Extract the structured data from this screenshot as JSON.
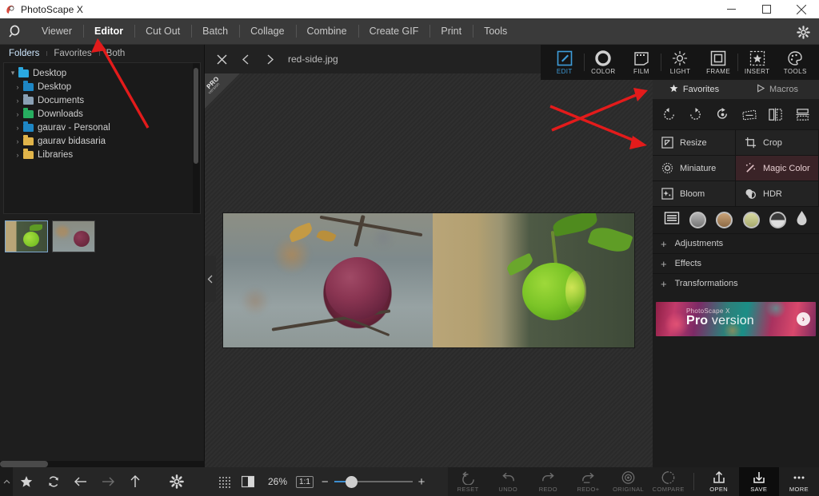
{
  "window": {
    "title": "PhotoScape X",
    "logo_icon": "photoscape-logo-icon",
    "minimize_icon": "minimize-icon",
    "maximize_icon": "maximize-icon",
    "close_icon": "close-icon"
  },
  "menubar": {
    "logo_icon": "magnifier-logo-icon",
    "gear_icon": "settings-gear-icon",
    "items": [
      {
        "label": "Viewer",
        "active": false
      },
      {
        "label": "Editor",
        "active": true
      },
      {
        "label": "Cut Out",
        "active": false
      },
      {
        "label": "Batch",
        "active": false
      },
      {
        "label": "Collage",
        "active": false
      },
      {
        "label": "Combine",
        "active": false
      },
      {
        "label": "Create GIF",
        "active": false
      },
      {
        "label": "Print",
        "active": false
      },
      {
        "label": "Tools",
        "active": false
      }
    ]
  },
  "left_panel": {
    "tabs": [
      {
        "label": "Folders",
        "active": true
      },
      {
        "label": "Favorites",
        "active": false
      },
      {
        "label": "Both",
        "active": false
      }
    ],
    "tree": [
      {
        "label": "Desktop",
        "indent": 0,
        "chevron": "▾",
        "color": "#2aa8e0"
      },
      {
        "label": "Desktop",
        "indent": 1,
        "chevron": "›",
        "color": "#1e86c4"
      },
      {
        "label": "Documents",
        "indent": 1,
        "chevron": "›",
        "color": "#8aa0b4"
      },
      {
        "label": "Downloads",
        "indent": 1,
        "chevron": "›",
        "color": "#27ae60"
      },
      {
        "label": "gaurav - Personal",
        "indent": 1,
        "chevron": "›",
        "color": "#1e86c4"
      },
      {
        "label": "gaurav bidasaria",
        "indent": 1,
        "chevron": "›",
        "color": "#e0b44a"
      },
      {
        "label": "Libraries",
        "indent": 1,
        "chevron": "›",
        "color": "#e0b44a"
      }
    ],
    "thumbnails": [
      {
        "name": "green-apple-thumbnail",
        "selected": true
      },
      {
        "name": "red-apple-thumbnail",
        "selected": false
      }
    ],
    "bottom_bar": [
      {
        "icon": "chevron-up-icon",
        "glyph": "⌃",
        "dim": true
      },
      {
        "icon": "star-icon",
        "glyph": "★",
        "dim": false
      },
      {
        "icon": "refresh-icon",
        "glyph": "⟳",
        "dim": false
      },
      {
        "icon": "back-arrow-icon",
        "glyph": "←",
        "dim": false
      },
      {
        "icon": "forward-arrow-icon",
        "glyph": "→",
        "dim": true
      },
      {
        "icon": "up-arrow-icon",
        "glyph": "↑",
        "dim": false
      },
      {
        "icon": "settings-gear-icon",
        "glyph": "⚙",
        "dim": false
      }
    ]
  },
  "center": {
    "close_icon": "close-file-icon",
    "prev_icon": "previous-image-icon",
    "next_icon": "next-image-icon",
    "filename": "red-side.jpg",
    "pro_ribbon": {
      "line1": "PRO",
      "line2": "version"
    },
    "collapse_handle_icon": "collapse-left-panel-icon",
    "zoom": {
      "grid_icon": "grid-overlay-icon",
      "split_icon": "split-view-icon",
      "percent": "26%",
      "actual_size_label": "1:1",
      "minus": "−",
      "plus": "+"
    }
  },
  "right_panel": {
    "toolbar": [
      {
        "label": "EDIT",
        "icon": "edit-pencil-icon",
        "active": true
      },
      {
        "label": "COLOR",
        "icon": "color-circle-icon",
        "active": false
      },
      {
        "label": "FILM",
        "icon": "film-icon",
        "active": false
      },
      {
        "label": "LIGHT",
        "icon": "light-sun-icon",
        "active": false
      },
      {
        "label": "FRAME",
        "icon": "frame-square-icon",
        "active": false
      },
      {
        "label": "INSERT",
        "icon": "insert-star-icon",
        "active": false
      },
      {
        "label": "TOOLS",
        "icon": "tools-palette-icon",
        "active": false
      }
    ],
    "fav_tabs": [
      {
        "label": "Favorites",
        "icon": "star-icon",
        "active": true
      },
      {
        "label": "Macros",
        "icon": "play-triangle-icon",
        "active": false
      }
    ],
    "rotate_icons": [
      "rotate-left-icon",
      "rotate-right-icon",
      "free-rotate-icon",
      "perspective-icon",
      "flip-horizontal-icon",
      "flip-vertical-icon"
    ],
    "tools": [
      {
        "label": "Resize",
        "icon": "resize-icon",
        "highlighted": false
      },
      {
        "label": "Crop",
        "icon": "crop-icon",
        "highlighted": false
      },
      {
        "label": "Miniature",
        "icon": "miniature-icon",
        "highlighted": false
      },
      {
        "label": "Magic Color",
        "icon": "magic-wand-icon",
        "highlighted": true
      },
      {
        "label": "Bloom",
        "icon": "bloom-icon",
        "highlighted": false
      },
      {
        "label": "HDR",
        "icon": "hdr-icon",
        "highlighted": false
      }
    ],
    "filters": [
      {
        "name": "filter-list-icon",
        "color": "none"
      },
      {
        "name": "filter-grey-circle",
        "color": "#9a9a9a"
      },
      {
        "name": "filter-sepia-circle",
        "color": "#b08a63"
      },
      {
        "name": "filter-warm-circle",
        "color": "#c9cc92"
      },
      {
        "name": "filter-split-circle",
        "color": "#d8d8d8"
      },
      {
        "name": "filter-drop-icon",
        "color": "#d0d0d0"
      }
    ],
    "sections": [
      {
        "label": "Adjustments",
        "expander": "+"
      },
      {
        "label": "Effects",
        "expander": "+"
      },
      {
        "label": "Transformations",
        "expander": "+"
      }
    ],
    "promo": {
      "brand": "PhotoScape X",
      "title_strong": "Pro",
      "title_rest": " version",
      "arrow_icon": "chevron-right-icon",
      "arrow_glyph": "›"
    }
  },
  "actions": [
    {
      "label": "RESET",
      "icon": "reset-icon",
      "enabled": false
    },
    {
      "label": "UNDO",
      "icon": "undo-icon",
      "enabled": false
    },
    {
      "label": "REDO",
      "icon": "redo-icon",
      "enabled": false
    },
    {
      "label": "REDO+",
      "icon": "redo-plus-icon",
      "enabled": false
    },
    {
      "label": "ORIGINAL",
      "icon": "original-icon",
      "enabled": false
    },
    {
      "label": "COMPARE",
      "icon": "compare-icon",
      "enabled": false
    },
    {
      "label": "OPEN",
      "icon": "open-upload-icon",
      "enabled": true
    },
    {
      "label": "SAVE",
      "icon": "save-download-icon",
      "enabled": true
    },
    {
      "label": "MORE",
      "icon": "more-dots-icon",
      "enabled": true
    }
  ],
  "annotations": {
    "arrow_color": "#e31b1b",
    "arrows": [
      {
        "name": "arrow-to-editor-tab"
      },
      {
        "name": "arrow-to-right-toolbar"
      },
      {
        "name": "arrow-to-resize-tool"
      }
    ]
  },
  "colors": {
    "accent": "#3e9ddb",
    "panel_bg": "#1c1c1c",
    "titlebar_bg": "#ffffff",
    "menubar_bg": "#3a3a3a",
    "highlight_row": "#3a2327"
  }
}
